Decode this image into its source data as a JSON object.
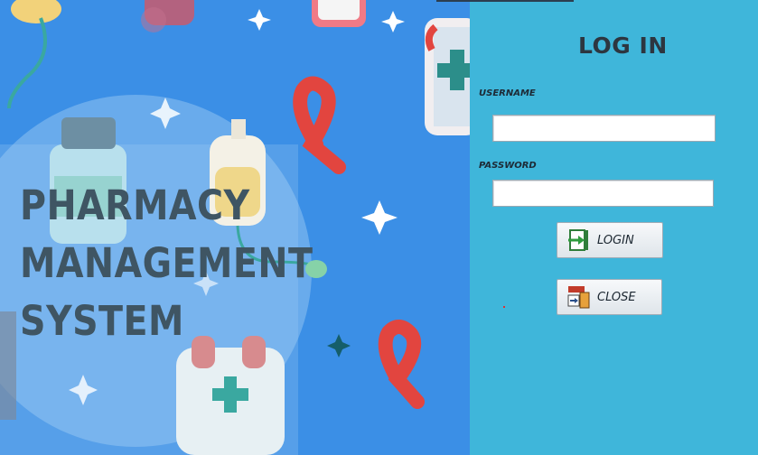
{
  "banner": {
    "title_lines": [
      "PHARMACY",
      "MANAGEMENT",
      "SYSTEM"
    ]
  },
  "login": {
    "heading": "LOG IN",
    "username_label": "USERNAME",
    "username_value": "",
    "password_label": "PASSWORD",
    "password_value": "",
    "login_button": "LOGIN",
    "close_button": "CLOSE"
  },
  "icons": {
    "login": "login-door-arrow-icon",
    "close": "exit-door-icon"
  },
  "colors": {
    "banner_bg": "#3b8fe6",
    "panel_bg": "#3fb6da",
    "title_text": "#3f5563",
    "ribbon_red": "#e2453f"
  }
}
